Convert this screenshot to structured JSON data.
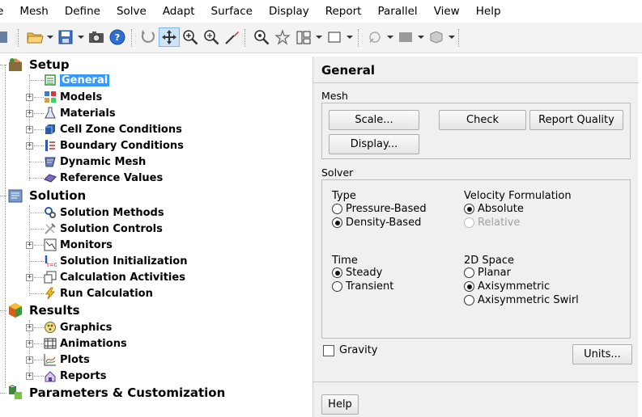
{
  "menubar": {
    "items": [
      "e",
      "Mesh",
      "Define",
      "Solve",
      "Adapt",
      "Surface",
      "Display",
      "Report",
      "Parallel",
      "View",
      "Help"
    ]
  },
  "toolbar": {
    "icons": [
      "open-folder-icon",
      "save-icon",
      "camera-icon",
      "info-icon",
      "rotate-icon",
      "pan-icon",
      "zoom-in-icon",
      "zoom-box-icon",
      "probe-icon",
      "fit-icon",
      "lights-icon",
      "layout-icon",
      "window-icon",
      "views-icon",
      "colormap-icon",
      "display-icon"
    ]
  },
  "tree": {
    "setup": {
      "label": "Setup",
      "items": [
        "General",
        "Models",
        "Materials",
        "Cell Zone Conditions",
        "Boundary Conditions",
        "Dynamic Mesh",
        "Reference Values"
      ],
      "selected": "General"
    },
    "solution": {
      "label": "Solution",
      "items": [
        "Solution Methods",
        "Solution Controls",
        "Monitors",
        "Solution Initialization",
        "Calculation Activities",
        "Run Calculation"
      ]
    },
    "results": {
      "label": "Results",
      "items": [
        "Graphics",
        "Animations",
        "Plots",
        "Reports"
      ]
    },
    "parameters": {
      "label": "Parameters & Customization"
    }
  },
  "panel": {
    "title": "General",
    "mesh": {
      "label": "Mesh",
      "buttons": {
        "scale": "Scale...",
        "check": "Check",
        "report_quality": "Report Quality",
        "display": "Display..."
      }
    },
    "solver": {
      "label": "Solver",
      "type": {
        "label": "Type",
        "options": [
          "Pressure-Based",
          "Density-Based"
        ],
        "selected": "Density-Based"
      },
      "velocity": {
        "label": "Velocity Formulation",
        "options": [
          "Absolute",
          "Relative"
        ],
        "selected": "Absolute",
        "disabled": [
          "Relative"
        ]
      },
      "time": {
        "label": "Time",
        "options": [
          "Steady",
          "Transient"
        ],
        "selected": "Steady"
      },
      "space": {
        "label": "2D Space",
        "options": [
          "Planar",
          "Axisymmetric",
          "Axisymmetric Swirl"
        ],
        "selected": "Axisymmetric"
      }
    },
    "gravity": {
      "label": "Gravity",
      "checked": false
    },
    "units_button": "Units...",
    "help_button": "Help"
  },
  "colors": {
    "selection": "#3399ff",
    "panel_bg": "#f0f0f0",
    "toolbar_bg": "#f3f3f3",
    "active_tool": "#cde3f7"
  }
}
